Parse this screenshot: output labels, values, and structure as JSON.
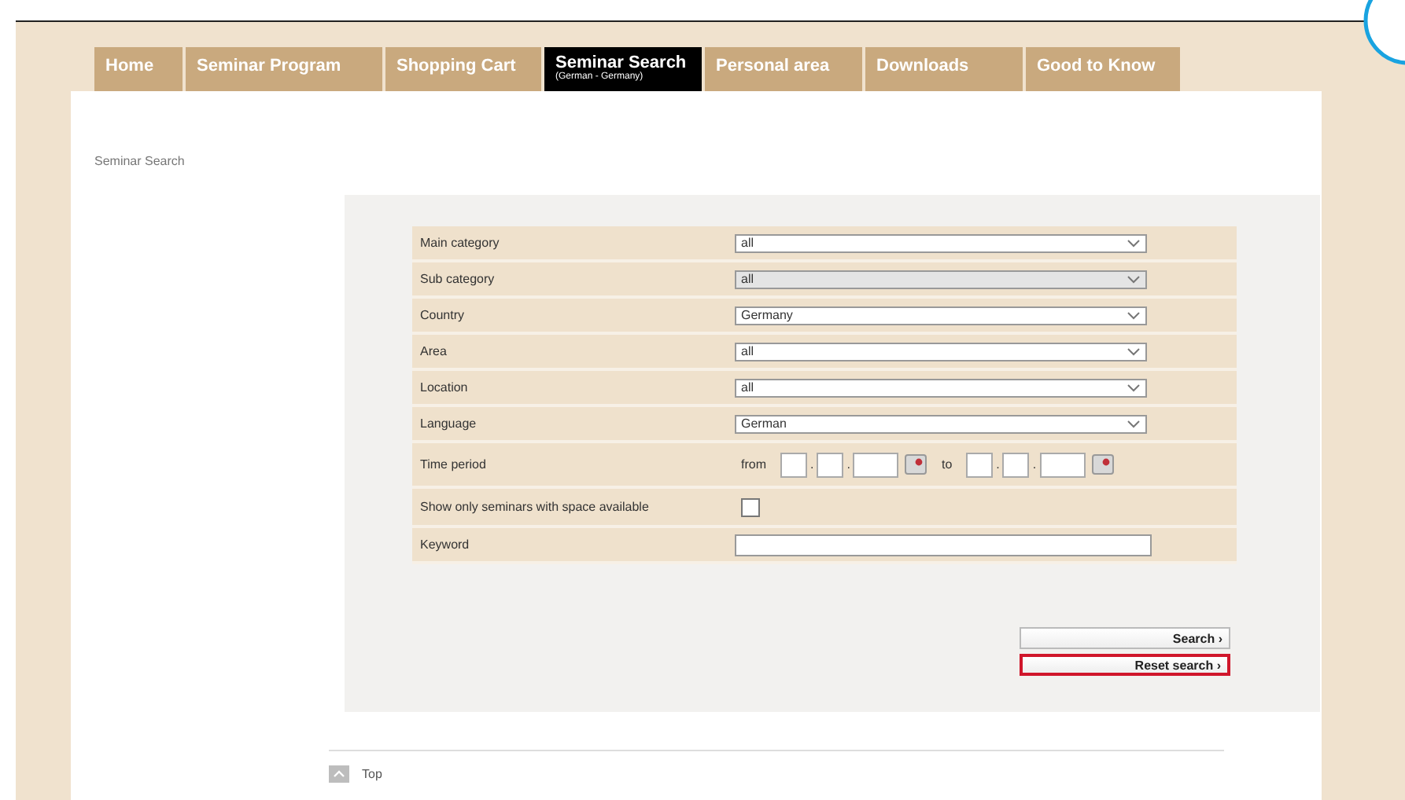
{
  "tabs": [
    {
      "label": "Home",
      "selected": false
    },
    {
      "label": "Seminar Program",
      "selected": false
    },
    {
      "label": "Shopping Cart",
      "selected": false
    },
    {
      "label": "Seminar Search",
      "sublabel": "(German - Germany)",
      "selected": true
    },
    {
      "label": "Personal area",
      "selected": false
    },
    {
      "label": "Downloads",
      "selected": false
    },
    {
      "label": "Good to Know",
      "selected": false
    }
  ],
  "breadcrumb": "Seminar Search",
  "form": [
    {
      "kind": "select",
      "label": "Main category",
      "value": "all",
      "disabled": false
    },
    {
      "kind": "select",
      "label": "Sub category",
      "value": "all",
      "disabled": true
    },
    {
      "kind": "select",
      "label": "Country",
      "value": "Germany",
      "disabled": false
    },
    {
      "kind": "select",
      "label": "Area",
      "value": "all",
      "disabled": false
    },
    {
      "kind": "select",
      "label": "Location",
      "value": "all",
      "disabled": false
    },
    {
      "kind": "select",
      "label": "Language",
      "value": "German",
      "disabled": false
    },
    {
      "kind": "dates",
      "label": "Time period",
      "from": "from",
      "to": "to",
      "separator": "."
    },
    {
      "kind": "checkbox",
      "label": "Show only seminars with space available",
      "checked": false
    },
    {
      "kind": "text",
      "label": "Keyword"
    }
  ],
  "buttons": [
    {
      "label": "Search ›",
      "highlighted": false
    },
    {
      "label": "Reset search ›",
      "highlighted": true
    }
  ],
  "top_link": "Top"
}
